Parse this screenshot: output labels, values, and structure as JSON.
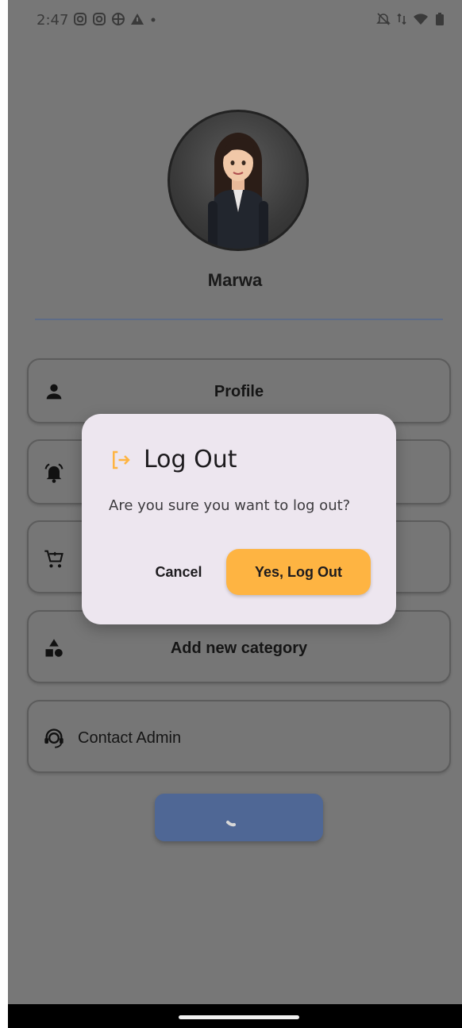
{
  "status_bar": {
    "time": "2:47",
    "left_icons": [
      "instagram-icon",
      "instagram-icon",
      "vpn-icon",
      "alert-icon",
      "dot-icon"
    ],
    "right_icons": [
      "mute-icon",
      "data-icon",
      "wifi-icon",
      "battery-icon"
    ]
  },
  "profile": {
    "name": "Marwa"
  },
  "menu": {
    "items": [
      {
        "label": "Profile",
        "icon": "person-icon"
      },
      {
        "label": "",
        "icon": "bell-icon"
      },
      {
        "label": "",
        "icon": "cart-icon"
      },
      {
        "label": "Add new category",
        "icon": "category-icon"
      },
      {
        "label": "Contact Admin",
        "icon": "support-agent-icon"
      }
    ]
  },
  "dialog": {
    "title": "Log Out",
    "message": "Are you sure you want to log out?",
    "cancel_label": "Cancel",
    "confirm_label": "Yes, Log Out",
    "accent_color": "#feb442"
  },
  "colors": {
    "scrim": "#777777",
    "primary": "#4f6795",
    "dialog_bg": "#ede6ef"
  }
}
